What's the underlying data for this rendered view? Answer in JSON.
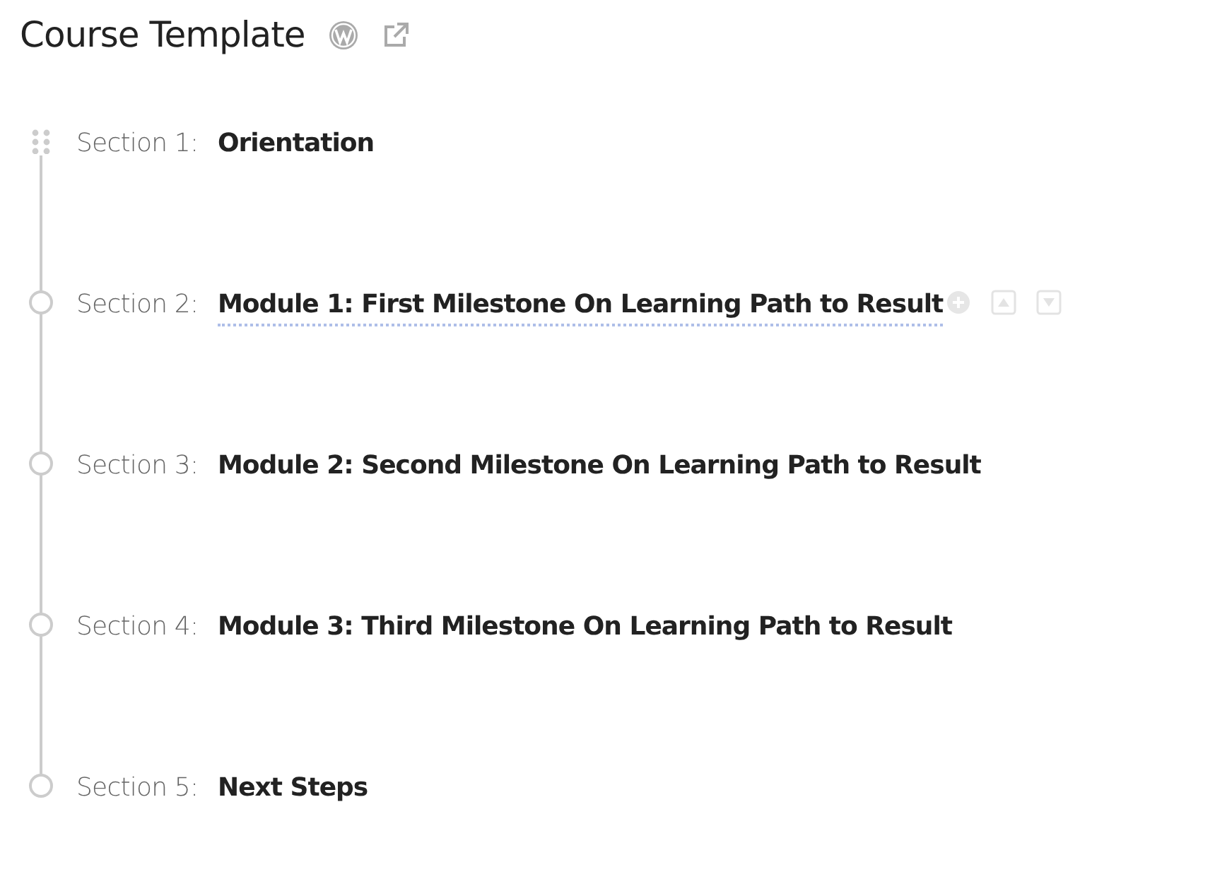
{
  "title": "Course Template",
  "sections": [
    {
      "kind": "handle",
      "label": "Section 1:",
      "title": "Orientation",
      "hovered": false
    },
    {
      "kind": "node",
      "label": "Section 2:",
      "title": "Module 1: First Milestone On Learning Path to Result",
      "hovered": true
    },
    {
      "kind": "node",
      "label": "Section 3:",
      "title": "Module 2: Second Milestone On Learning Path to Result",
      "hovered": false
    },
    {
      "kind": "node",
      "label": "Section 4:",
      "title": "Module 3: Third Milestone On Learning Path to Result",
      "hovered": false
    },
    {
      "kind": "node",
      "label": "Section 5:",
      "title": "Next Steps",
      "hovered": false
    }
  ]
}
